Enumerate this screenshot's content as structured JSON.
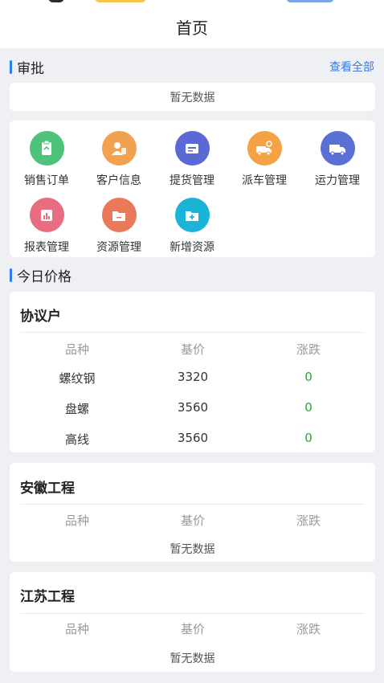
{
  "header": {
    "title": "首页"
  },
  "approval": {
    "title": "审批",
    "view_all": "查看全部",
    "empty": "暂无数据"
  },
  "menu": [
    {
      "label": "销售订单",
      "icon": "sales-order-icon",
      "color": "#4cc27a"
    },
    {
      "label": "客户信息",
      "icon": "customer-info-icon",
      "color": "#f2a24e"
    },
    {
      "label": "提货管理",
      "icon": "pickup-management-icon",
      "color": "#5a69d6"
    },
    {
      "label": "派车管理",
      "icon": "dispatch-management-icon",
      "color": "#f5a247"
    },
    {
      "label": "运力管理",
      "icon": "capacity-management-icon",
      "color": "#5b70d4"
    },
    {
      "label": "报表管理",
      "icon": "report-management-icon",
      "color": "#e86d80"
    },
    {
      "label": "资源管理",
      "icon": "resource-management-icon",
      "color": "#e8795a"
    },
    {
      "label": "新增资源",
      "icon": "add-resource-icon",
      "color": "#1cb3d8"
    }
  ],
  "prices": {
    "title": "今日价格",
    "groups": [
      {
        "name": "协议户",
        "columns": [
          "品种",
          "基价",
          "涨跌"
        ],
        "rows": [
          {
            "variety": "螺纹钢",
            "base": "3320",
            "change": "0"
          },
          {
            "variety": "盘螺",
            "base": "3560",
            "change": "0"
          },
          {
            "variety": "高线",
            "base": "3560",
            "change": "0"
          }
        ]
      },
      {
        "name": "安徽工程",
        "columns": [
          "品种",
          "基价",
          "涨跌"
        ],
        "empty": "暂无数据"
      },
      {
        "name": "江苏工程",
        "columns": [
          "品种",
          "基价",
          "涨跌"
        ],
        "empty": "暂无数据"
      }
    ]
  }
}
